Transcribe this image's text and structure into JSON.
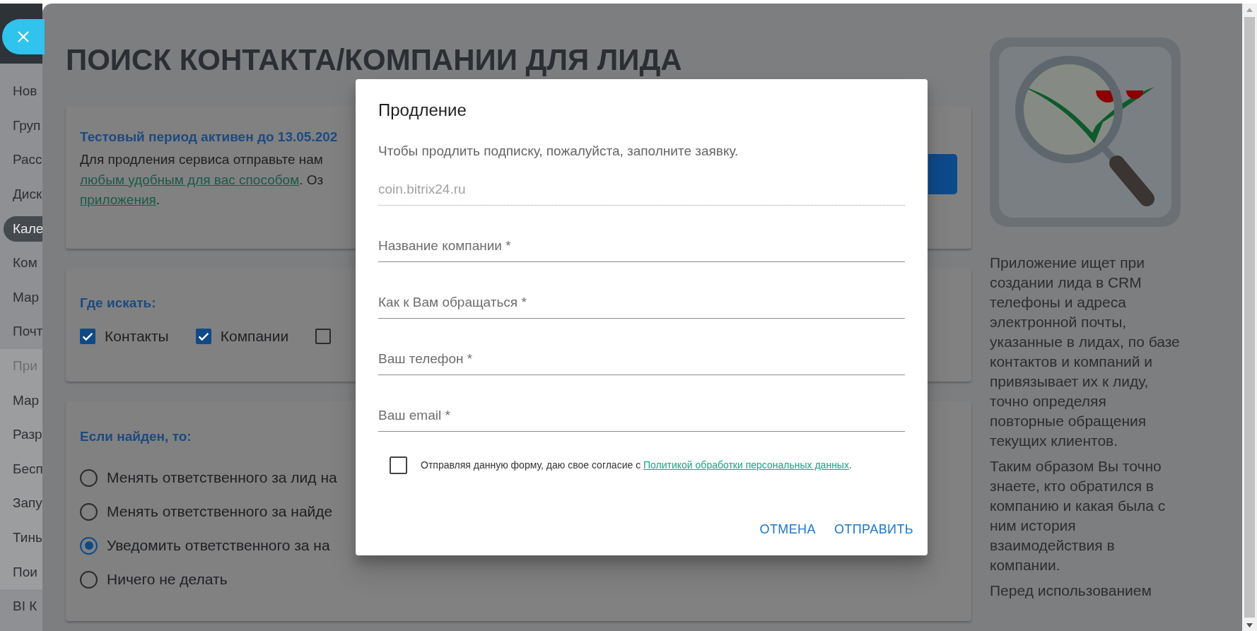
{
  "sidebar": {
    "items": [
      {
        "label": "Нов",
        "selected": false
      },
      {
        "label": "Груп",
        "selected": false
      },
      {
        "label": "Расс",
        "selected": false
      },
      {
        "label": "Диск",
        "selected": false
      },
      {
        "label": "Кале",
        "selected": true
      },
      {
        "label": "Ком",
        "selected": false
      },
      {
        "label": "Мар",
        "selected": false
      },
      {
        "label": "Почт",
        "selected": false
      }
    ],
    "group": {
      "title": "При",
      "items": [
        {
          "label": "Мар",
          "selected": false
        },
        {
          "label": "Разр",
          "selected": false
        },
        {
          "label": "Бесп",
          "selected": false
        },
        {
          "label": "Запу",
          "selected": false
        },
        {
          "label": "Тинь",
          "selected": false
        },
        {
          "label": "Пои",
          "selected": false
        }
      ]
    },
    "items_after": [
      {
        "label": "BI К",
        "selected": false
      }
    ]
  },
  "page": {
    "title": "ПОИСК КОНТАКТА/КОМПАНИИ ДЛЯ ЛИДА",
    "trial": {
      "title": "Тестовый период активен до 13.05.202",
      "lines": [
        [
          {
            "text": "Для продления сервиса отправьте нам",
            "link": false
          }
        ],
        [
          {
            "text": "любым удобным для вас способом",
            "link": true
          },
          {
            "text": ". Оз",
            "link": false
          }
        ],
        [
          {
            "text": "приложения",
            "link": true
          },
          {
            "text": ".",
            "link": false
          }
        ]
      ]
    },
    "search_in": {
      "title": "Где искать:",
      "options": [
        {
          "label": "Контакты",
          "checked": true
        },
        {
          "label": "Компании",
          "checked": true
        },
        {
          "checked": false
        }
      ]
    },
    "if_found": {
      "title": "Если найден, то:",
      "options": [
        {
          "label": "Менять ответственного за лид на",
          "selected": false
        },
        {
          "label": "Менять ответственного за найде",
          "selected": false
        },
        {
          "label": "Уведомить ответственного за на",
          "selected": true
        },
        {
          "label": "Ничего не делать",
          "selected": false
        }
      ]
    },
    "description": [
      "Приложение ищет при создании лида в CRM телефоны и адреса электронной почты, указанные в лидах, по базе контактов и компаний и привязывает их к лиду, точно определяя повторные обращения текущих клиентов.",
      "Таким образом Вы точно знаете, кто обратился в компанию и какая была с ним история взаимодействия в компании.",
      "Перед использованием"
    ]
  },
  "dialog": {
    "title": "Продление",
    "subtitle": "Чтобы продлить подписку, пожалуйста, заполните заявку.",
    "fields": [
      {
        "value": "coin.bitrix24.ru",
        "disabled": true
      },
      {
        "placeholder": "Название компании *",
        "disabled": false
      },
      {
        "placeholder": "Как к Вам обращаться *",
        "disabled": false
      },
      {
        "placeholder": "Ваш телефон *",
        "disabled": false
      },
      {
        "placeholder": "Ваш email *",
        "disabled": false
      }
    ],
    "consent": {
      "checked": false,
      "text": "Отправляя данную форму, даю свое согласие с ",
      "link": "Политикой обработки персональных данных",
      "after": "."
    },
    "buttons": [
      "ОТМЕНА",
      "ОТПРАВИТЬ"
    ]
  }
}
